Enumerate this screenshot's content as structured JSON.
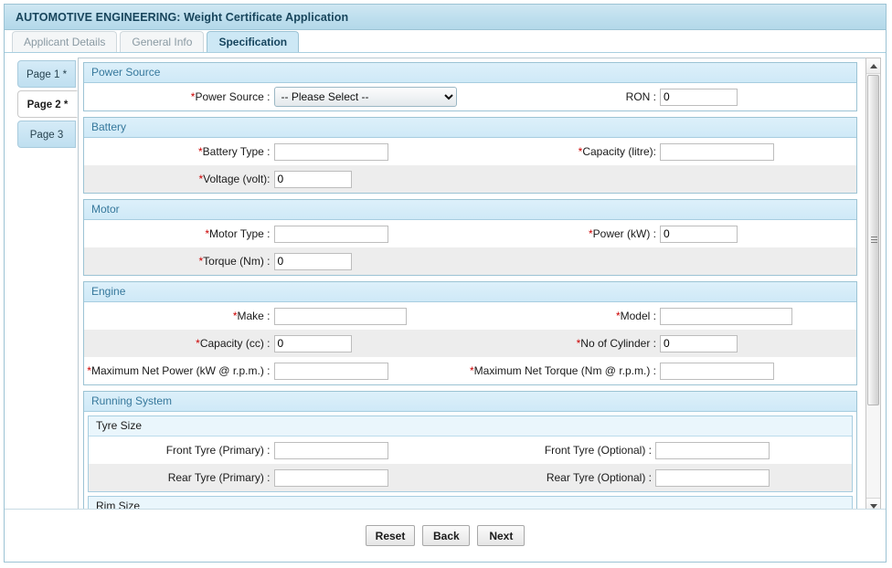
{
  "window": {
    "title": "AUTOMOTIVE ENGINEERING: Weight Certificate Application"
  },
  "tabs": [
    {
      "label": "Applicant Details",
      "active": false
    },
    {
      "label": "General Info",
      "active": false
    },
    {
      "label": "Specification",
      "active": true
    }
  ],
  "page_tabs": [
    {
      "label": "Page 1 *",
      "active": false
    },
    {
      "label": "Page 2 *",
      "active": true
    },
    {
      "label": "Page 3",
      "active": false
    }
  ],
  "sections": {
    "power_source": {
      "header": "Power Source",
      "power_source_label": "Power Source :",
      "power_source_value": "-- Please Select --",
      "power_source_options": [
        "-- Please Select --"
      ],
      "ron_label": "RON :",
      "ron_value": "0"
    },
    "battery": {
      "header": "Battery",
      "battery_type_label": "Battery Type :",
      "battery_type_value": "",
      "capacity_label": "Capacity (litre):",
      "capacity_value": "",
      "voltage_label": "Voltage (volt):",
      "voltage_value": "0"
    },
    "motor": {
      "header": "Motor",
      "motor_type_label": "Motor Type :",
      "motor_type_value": "",
      "power_label": "Power (kW) :",
      "power_value": "0",
      "torque_label": "Torque (Nm) :",
      "torque_value": "0"
    },
    "engine": {
      "header": "Engine",
      "make_label": "Make :",
      "make_value": "",
      "model_label": "Model :",
      "model_value": "",
      "capacity_label": "Capacity (cc) :",
      "capacity_value": "0",
      "cylinder_label": "No of Cylinder :",
      "cylinder_value": "0",
      "max_net_power_label": "Maximum Net Power (kW @ r.p.m.) :",
      "max_net_power_value": "",
      "max_net_torque_label": "Maximum Net Torque (Nm @ r.p.m.) :",
      "max_net_torque_value": ""
    },
    "running_system": {
      "header": "Running System",
      "tyre_size": {
        "header": "Tyre Size",
        "front_primary_label": "Front Tyre (Primary) :",
        "front_primary_value": "",
        "front_optional_label": "Front Tyre (Optional) :",
        "front_optional_value": "",
        "rear_primary_label": "Rear Tyre (Primary) :",
        "rear_primary_value": "",
        "rear_optional_label": "Rear Tyre (Optional) :",
        "rear_optional_value": ""
      },
      "rim_size": {
        "header": "Rim Size"
      }
    }
  },
  "required_marker": "*",
  "footer": {
    "reset": "Reset",
    "back": "Back",
    "next": "Next"
  },
  "colors": {
    "title_bar": "#bfdfee",
    "title_text": "#18455c",
    "panel_header_bg": "#cfe9f7",
    "panel_header_text": "#36789c",
    "active_tab_bg": "#cde8f5",
    "required_asterisk": "#cc0000",
    "alt_row_bg": "#ededed",
    "frame_border": "#9cc3d4"
  }
}
